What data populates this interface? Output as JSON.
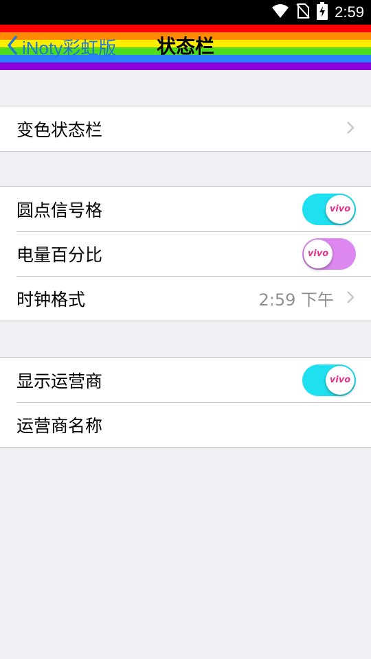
{
  "status_bar": {
    "time": "2:59",
    "icons": [
      "wifi-icon",
      "no-sim-icon",
      "battery-charging-icon"
    ]
  },
  "nav": {
    "back_label": "iNoty彩虹版",
    "title": "状态栏",
    "rainbow_colors": [
      "#ff0000",
      "#ff8c00",
      "#ffee00",
      "#4ddc1e",
      "#2a7fff",
      "#8b00d8"
    ]
  },
  "groups": [
    {
      "rows": [
        {
          "label": "变色状态栏",
          "type": "link"
        }
      ]
    },
    {
      "rows": [
        {
          "label": "圆点信号格",
          "type": "toggle",
          "on": true,
          "knob_text": "vivo"
        },
        {
          "label": "电量百分比",
          "type": "toggle",
          "on": false,
          "knob_text": "vivo"
        },
        {
          "label": "时钟格式",
          "type": "link",
          "value": "2:59 下午"
        }
      ]
    },
    {
      "rows": [
        {
          "label": "显示运营商",
          "type": "toggle",
          "on": true,
          "knob_text": "vivo"
        },
        {
          "label": "运营商名称",
          "type": "text"
        }
      ]
    }
  ],
  "colors": {
    "background": "#efeff4",
    "accent": "#1e7bd4",
    "toggle_on": "#1fe0f0",
    "toggle_off": "#dd88f0",
    "knob_text": "#e0348c"
  }
}
